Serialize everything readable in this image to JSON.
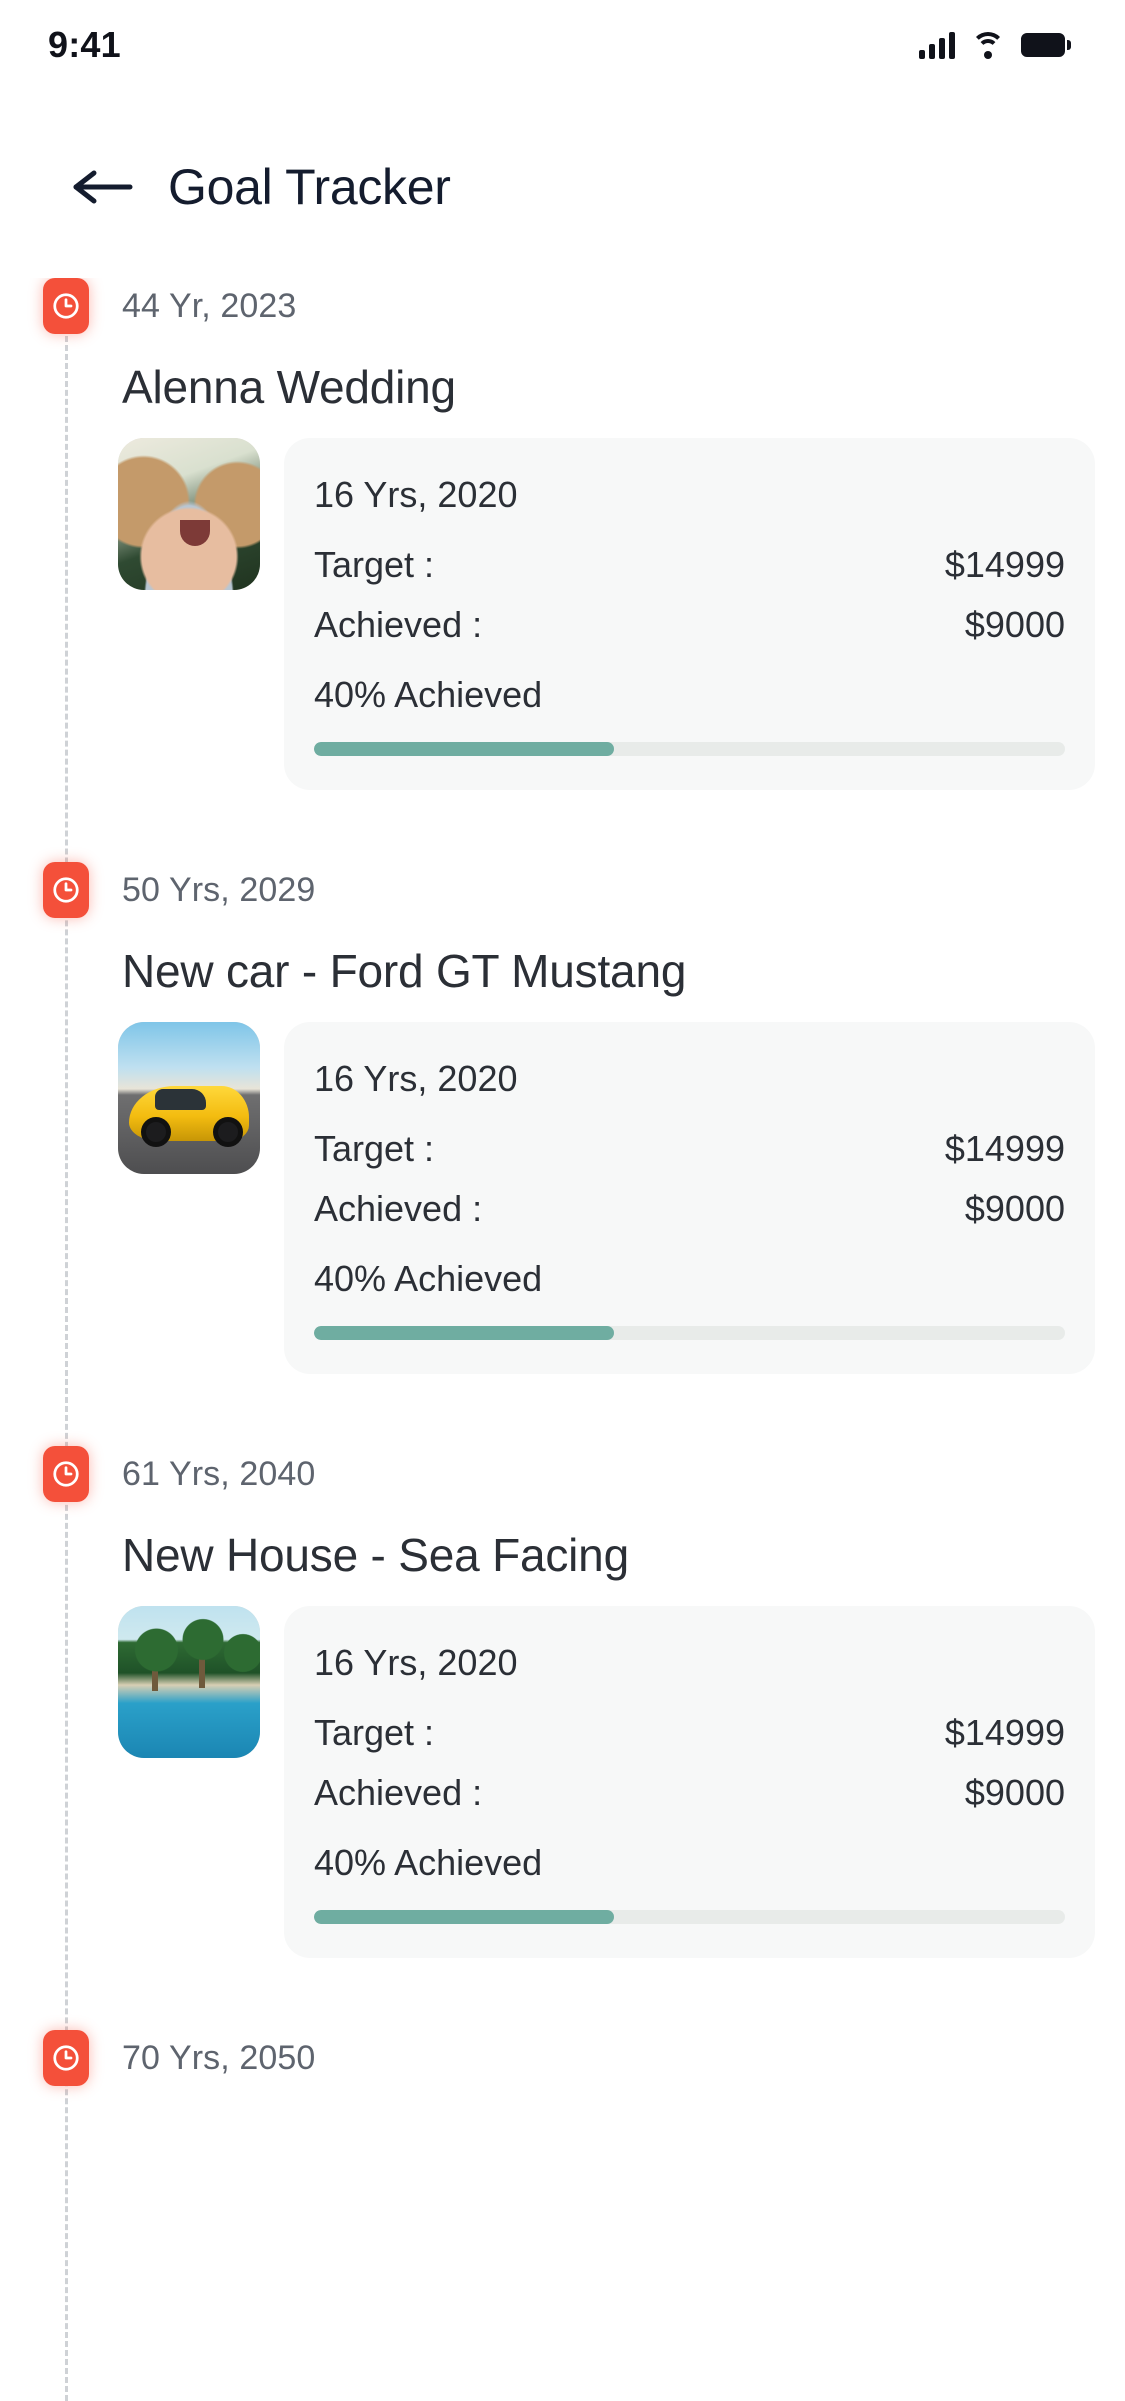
{
  "status_bar": {
    "time": "9:41",
    "icons": [
      "cellular-signal-icon",
      "wifi-icon",
      "battery-icon"
    ]
  },
  "app_bar": {
    "back_icon": "arrow-left-icon",
    "title": "Goal Tracker"
  },
  "colors": {
    "accent_badge": "#F4503A",
    "progress_fill": "#6FADA1",
    "progress_track": "#E8EBE9",
    "card_background": "#F7F8F8",
    "title_text": "#141C2E",
    "muted_text": "#5E646E"
  },
  "timeline": {
    "marker_icon": "clock-icon",
    "entries": [
      {
        "age_label": "44 Yr, 2023",
        "title": "Alenna Wedding",
        "thumbnail": "child-portrait-photo",
        "card": {
          "date": "16 Yrs, 2020",
          "target_label": "Target  :",
          "target_value": "$14999",
          "achieved_label": "Achieved :",
          "achieved_value": "$9000",
          "percent_label": "40% Achieved",
          "percent": 40
        }
      },
      {
        "age_label": "50 Yrs, 2029",
        "title": "New car - Ford GT Mustang",
        "thumbnail": "yellow-sports-car-photo",
        "card": {
          "date": "16 Yrs, 2020",
          "target_label": "Target  :",
          "target_value": "$14999",
          "achieved_label": "Achieved :",
          "achieved_value": "$9000",
          "percent_label": "40% Achieved",
          "percent": 40
        }
      },
      {
        "age_label": "61 Yrs, 2040",
        "title": "New House - Sea Facing",
        "thumbnail": "tropical-resort-pool-photo",
        "card": {
          "date": "16 Yrs, 2020",
          "target_label": "Target  :",
          "target_value": "$14999",
          "achieved_label": "Achieved :",
          "achieved_value": "$9000",
          "percent_label": "40% Achieved",
          "percent": 40
        }
      },
      {
        "age_label": "70 Yrs, 2050",
        "title": "",
        "thumbnail": "",
        "card": null
      }
    ]
  }
}
